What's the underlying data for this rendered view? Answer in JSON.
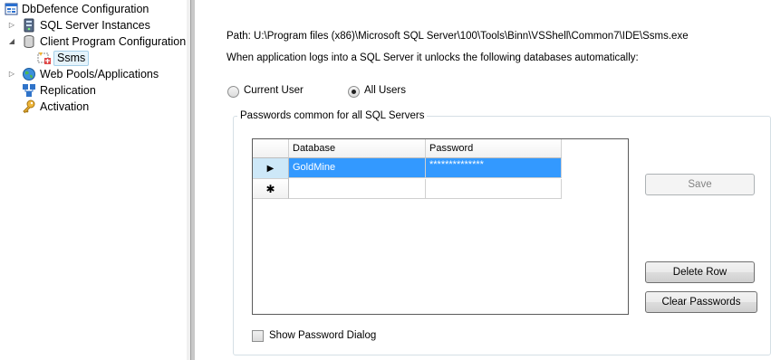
{
  "tree": {
    "root": "DbDefence Configuration",
    "items": [
      {
        "label": "SQL Server Instances",
        "expander": "▷",
        "icon": "server-icon"
      },
      {
        "label": "Client Program Configuration",
        "expander": "◢",
        "icon": "database-icon"
      },
      {
        "label": "Ssms",
        "expander": "",
        "icon": "program-icon",
        "selected": true
      },
      {
        "label": "Web Pools/Applications",
        "expander": "▷",
        "icon": "globe-icon"
      },
      {
        "label": "Replication",
        "expander": "",
        "icon": "replication-icon"
      },
      {
        "label": "Activation",
        "expander": "",
        "icon": "key-icon"
      }
    ]
  },
  "panel": {
    "path": "Path: U:\\Program files (x86)\\Microsoft SQL Server\\100\\Tools\\Binn\\VSShell\\Common7\\IDE\\Ssms.exe",
    "description": "When application logs into a SQL Server it unlocks the following databases automatically:",
    "radio_current_user": "Current User",
    "radio_all_users": "All Users",
    "selected_scope": "All Users",
    "group_title": "Passwords common for all SQL Servers",
    "grid": {
      "columns": [
        "Database",
        "Password"
      ],
      "rows": [
        {
          "database": "GoldMine",
          "password": "**************",
          "row_marker": "▶"
        },
        {
          "database": "",
          "password": "",
          "row_marker": "✱"
        }
      ]
    },
    "buttons": {
      "save": "Save",
      "delete_row": "Delete Row",
      "clear_passwords": "Clear Passwords"
    },
    "show_password_dialog": "Show Password Dialog",
    "show_password_checked": false
  }
}
